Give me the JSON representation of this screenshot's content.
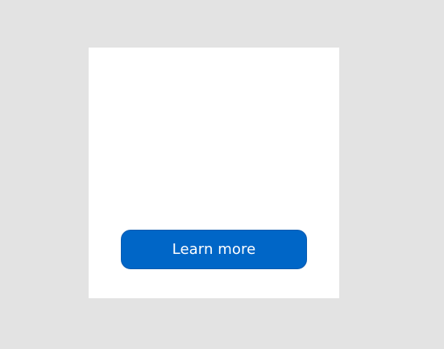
{
  "card": {
    "button_label": "Learn more"
  },
  "colors": {
    "page_background": "#e3e3e3",
    "card_background": "#ffffff",
    "button_background": "#0066c7",
    "button_text": "#ffffff"
  }
}
